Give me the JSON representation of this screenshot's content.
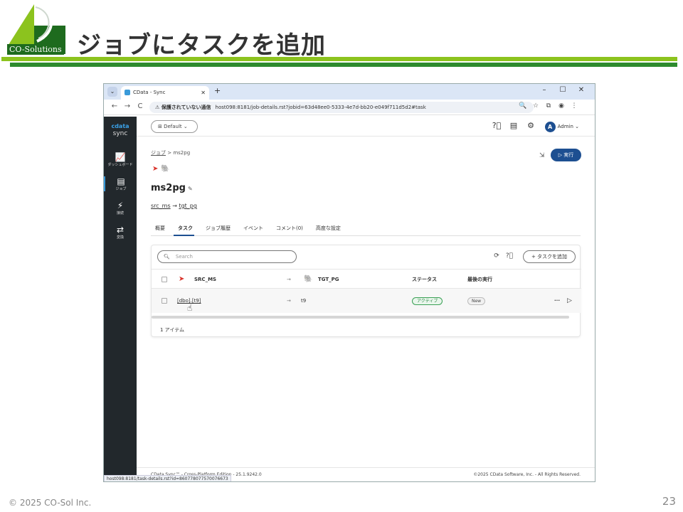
{
  "slide": {
    "title": "ジョブにタスクを追加",
    "logo_text": "CO-Solutions",
    "copyright": "© 2025 CO-Sol Inc.",
    "page_number": "23",
    "colors": {
      "bar_light": "#8cc31e",
      "bar_dark": "#2e8b2e"
    }
  },
  "browser": {
    "tab_title": "CData - Sync",
    "tab_close": "✕",
    "new_tab": "+",
    "window_controls": [
      "–",
      "☐",
      "✕"
    ],
    "nav_icons": [
      "←",
      "→",
      "C"
    ],
    "security_warning": "保護されていない通信",
    "url": "host098:8181/job-details.rst?jobid=63d48ee0-5333-4e7d-bb20-e049f711d5d2#task",
    "status_url": "host098:8181/task-details.rst?id=860778077570076673"
  },
  "app": {
    "brand_top": "cdata",
    "brand_bottom": "sync",
    "sidebar": [
      {
        "icon": "📈",
        "label": "ダッシュボード"
      },
      {
        "icon": "▤",
        "label": "ジョブ"
      },
      {
        "icon": "⚡",
        "label": "接続"
      },
      {
        "icon": "⇄",
        "label": "変換"
      }
    ],
    "workspace": "Default",
    "user": {
      "initial": "A",
      "name": "Admin"
    },
    "breadcrumb": {
      "root": "ジョブ",
      "sep": ">",
      "current": "ms2pg"
    },
    "run_button": "実行",
    "job_name": "ms2pg",
    "source_conn": "src_ms",
    "target_conn": "tgt_pg",
    "arrow": "→",
    "tabs": [
      "概要",
      "タスク",
      "ジョブ履歴",
      "イベント",
      "コメント(0)",
      "高度な設定"
    ],
    "active_tab": "タスク",
    "search_placeholder": "Search",
    "add_task": "タスクを追加",
    "table": {
      "headers": {
        "source": "SRC_MS",
        "target": "TGT_PG",
        "status": "ステータス",
        "last_run": "最後の実行"
      },
      "rows": [
        {
          "source": "[dbo].[t9]",
          "target": "t9",
          "status": "アクティブ",
          "last_run": "New",
          "more": "···",
          "run": "▷"
        }
      ]
    },
    "item_count": "1 アイテム",
    "footer_left": "CData Sync™ - Cross-Platform Edition - 25.1.9242.0",
    "footer_right": "©2025 CData Software, Inc. - All Rights Reserved."
  }
}
